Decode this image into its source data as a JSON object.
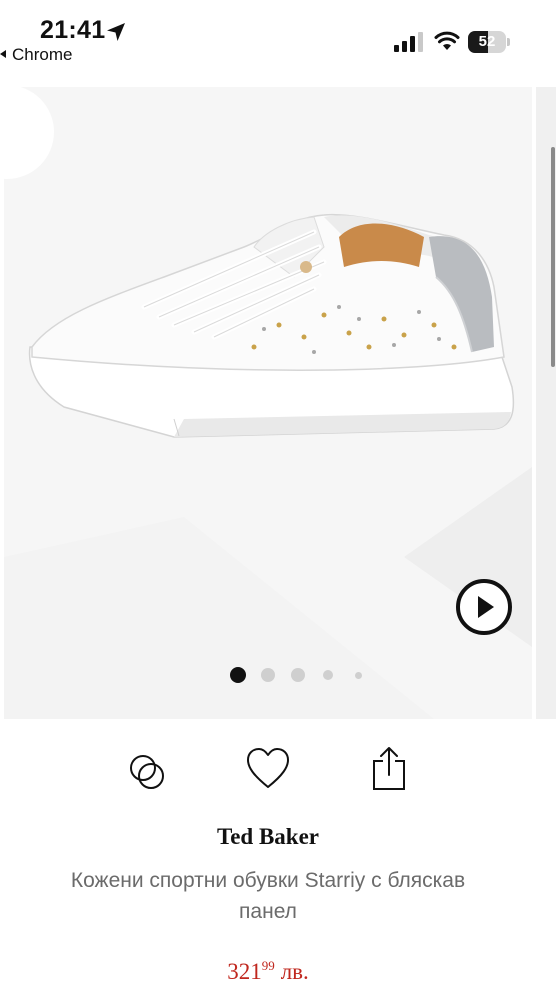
{
  "status_bar": {
    "time": "21:41",
    "back_app": "Chrome",
    "battery_percent": "52",
    "battery_level": 0.52,
    "signal_bars_active": 3,
    "icons": [
      "location-arrow-icon",
      "cellular-signal-icon",
      "wifi-icon",
      "battery-icon"
    ]
  },
  "gallery": {
    "image_count": 5,
    "active_index": 0,
    "controls": [
      "back-chevron-icon",
      "play-video-icon"
    ]
  },
  "actions": {
    "icons": [
      "compare-circles-icon",
      "heart-icon",
      "share-icon"
    ]
  },
  "product": {
    "brand": "Ted Baker",
    "title": "Кожени спортни обувки Starriy с бляскав панел",
    "price_main": "321",
    "price_cents": "99",
    "currency": "лв."
  },
  "colors": {
    "price": "#c0271e",
    "gallery_bg": "#f4f4f4",
    "glitter_heel": "#b9bcc0"
  }
}
